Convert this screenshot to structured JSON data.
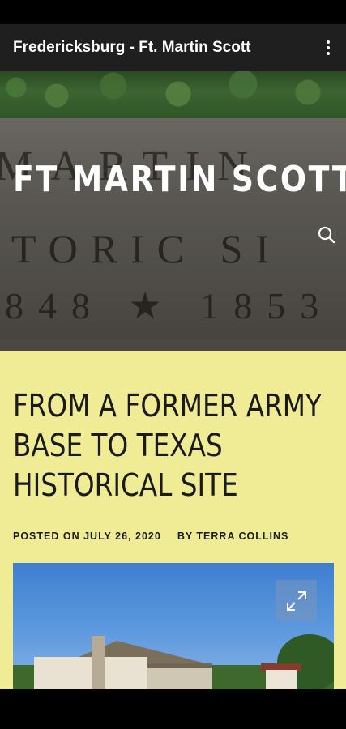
{
  "app_bar": {
    "title": "Fredericksburg - Ft. Martin Scott",
    "menu_icon": "more-vert-icon"
  },
  "hero": {
    "site_title": "FT MARTIN SCOTT",
    "stone_line1": "MARTIN",
    "stone_line2": "TORIC  SI",
    "stone_line3": "848 ★ 1853",
    "search_icon": "search-icon"
  },
  "post": {
    "title": "FROM A FORMER ARMY BASE TO TEXAS HISTORICAL SITE",
    "posted_on": "POSTED ON JULY 26, 2020",
    "author": "BY TERRA COLLINS",
    "expand_icon": "expand-icon"
  },
  "colors": {
    "app_bar": "#1f1f1f",
    "content_bg": "#efec95",
    "text": "#1a1a1a"
  }
}
